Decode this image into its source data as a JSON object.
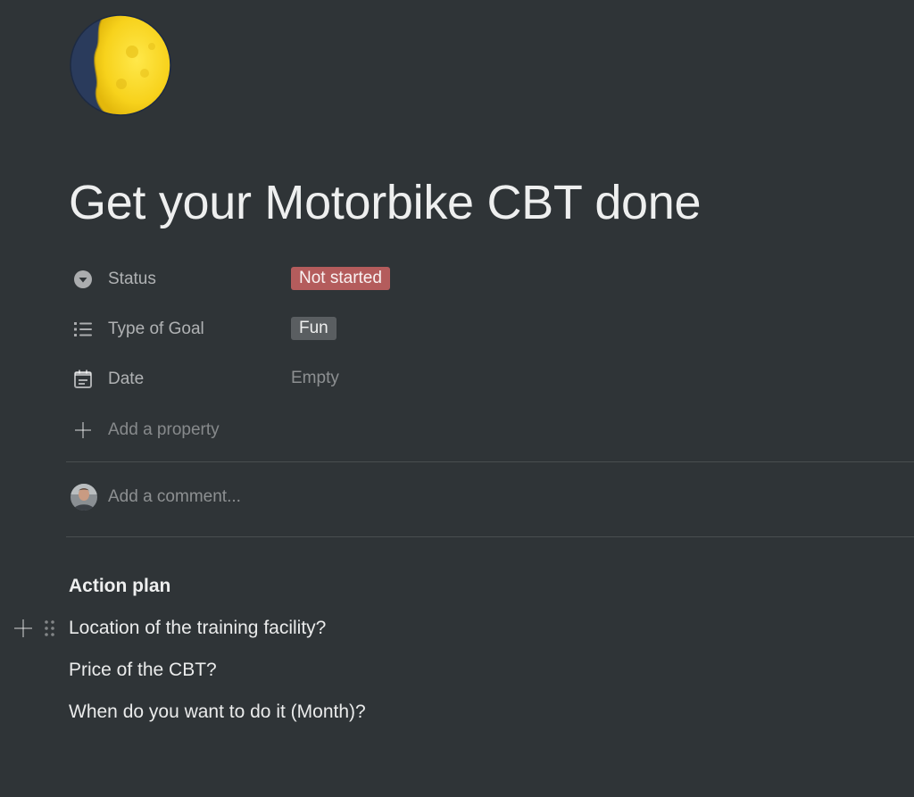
{
  "page": {
    "title": "Get your Motorbike CBT done",
    "icon": "moon-icon"
  },
  "properties": [
    {
      "icon": "status-icon",
      "label": "Status",
      "value": "Not started",
      "value_type": "tag",
      "tag_color": "#b45c5c"
    },
    {
      "icon": "list-icon",
      "label": "Type of Goal",
      "value": "Fun",
      "value_type": "tag",
      "tag_color": "#5a5e61"
    },
    {
      "icon": "calendar-icon",
      "label": "Date",
      "value": "Empty",
      "value_type": "empty"
    }
  ],
  "add_property": {
    "icon": "plus-icon",
    "label": "Add a property"
  },
  "comment": {
    "placeholder": "Add a comment...",
    "avatar": "user-avatar"
  },
  "content": {
    "heading": "Action plan",
    "blocks": [
      "Location of the training facility?",
      "Price of the CBT?",
      "When do you want to do it (Month)?"
    ]
  },
  "colors": {
    "background": "#2f3437",
    "status_red": "#b45c5c",
    "tag_gray": "#5a5e61"
  }
}
